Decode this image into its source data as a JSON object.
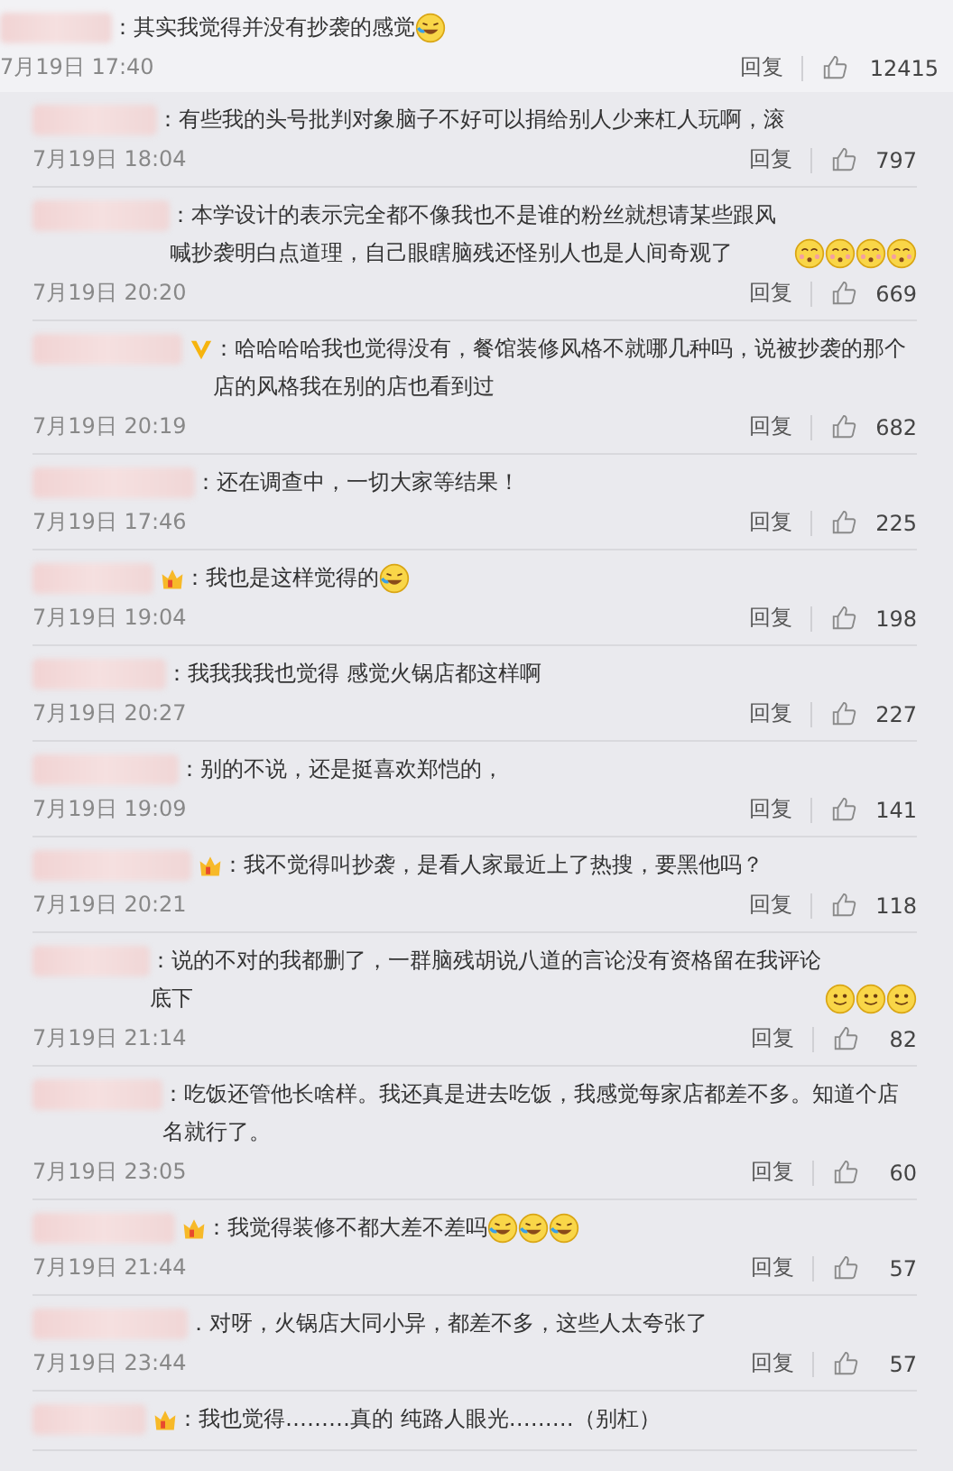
{
  "comment": {
    "text": "：其实我觉得并没有抄袭的感觉",
    "emojis": [
      {
        "kind": "laugh_cry"
      }
    ],
    "date": "7月19日 17:40",
    "reply_label": "回复",
    "likes": "12415"
  },
  "replies": [
    {
      "text": "：有些我的头号批判对象脑子不好可以捐给别人少来杠人玩啊，滚",
      "date": "7月19日 18:04",
      "reply_label": "回复",
      "likes": "797"
    },
    {
      "text": "：本学设计的表示完全都不像我也不是谁的粉丝就想请某些跟风喊抄袭明白点道理，自己眼瞎脑残还怪别人也是人间奇观了",
      "emojis": [
        {
          "kind": "shy"
        },
        {
          "kind": "shy"
        },
        {
          "kind": "shy"
        },
        {
          "kind": "shy"
        }
      ],
      "date": "7月19日 20:20",
      "reply_label": "回复",
      "likes": "669"
    },
    {
      "badge": {
        "kind": "verified"
      },
      "text": "：哈哈哈哈我也觉得没有，餐馆装修风格不就哪几种吗，说被抄袭的那个店的风格我在别的店也看到过",
      "date": "7月19日 20:19",
      "reply_label": "回复",
      "likes": "682"
    },
    {
      "text": "：还在调查中，一切大家等结果！",
      "date": "7月19日 17:46",
      "reply_label": "回复",
      "likes": "225"
    },
    {
      "badge": {
        "kind": "vip"
      },
      "text": "：我也是这样觉得的",
      "emojis": [
        {
          "kind": "laugh_cry"
        }
      ],
      "date": "7月19日 19:04",
      "reply_label": "回复",
      "likes": "198"
    },
    {
      "text": "：我我我我也觉得 感觉火锅店都这样啊",
      "date": "7月19日 20:27",
      "reply_label": "回复",
      "likes": "227"
    },
    {
      "text": "：别的不说，还是挺喜欢郑恺的，",
      "date": "7月19日 19:09",
      "reply_label": "回复",
      "likes": "141"
    },
    {
      "badge": {
        "kind": "vip"
      },
      "text": "：我不觉得叫抄袭，是看人家最近上了热搜，要黑他吗？",
      "date": "7月19日 20:21",
      "reply_label": "回复",
      "likes": "118"
    },
    {
      "text": "：说的不对的我都删了，一群脑残胡说八道的言论没有资格留在我评论底下",
      "emojis": [
        {
          "kind": "smile"
        },
        {
          "kind": "smile"
        },
        {
          "kind": "smile"
        }
      ],
      "date": "7月19日 21:14",
      "reply_label": "回复",
      "likes": "82"
    },
    {
      "text": "：吃饭还管他长啥样。我还真是进去吃饭，我感觉每家店都差不多。知道个店名就行了。",
      "date": "7月19日 23:05",
      "reply_label": "回复",
      "likes": "60"
    },
    {
      "badge": {
        "kind": "vip"
      },
      "text": "：我觉得装修不都大差不差吗",
      "emojis": [
        {
          "kind": "laugh_cry"
        },
        {
          "kind": "laugh_cry"
        },
        {
          "kind": "laugh_cry"
        }
      ],
      "date": "7月19日 21:44",
      "reply_label": "回复",
      "likes": "57"
    },
    {
      "text": "．对呀，火锅店大同小异，都差不多，这些人太夸张了",
      "date": "7月19日 23:44",
      "reply_label": "回复",
      "likes": "57"
    },
    {
      "badge": {
        "kind": "vip"
      },
      "text": "：我也觉得………真的 纯路人眼光………（别杠）"
    }
  ]
}
